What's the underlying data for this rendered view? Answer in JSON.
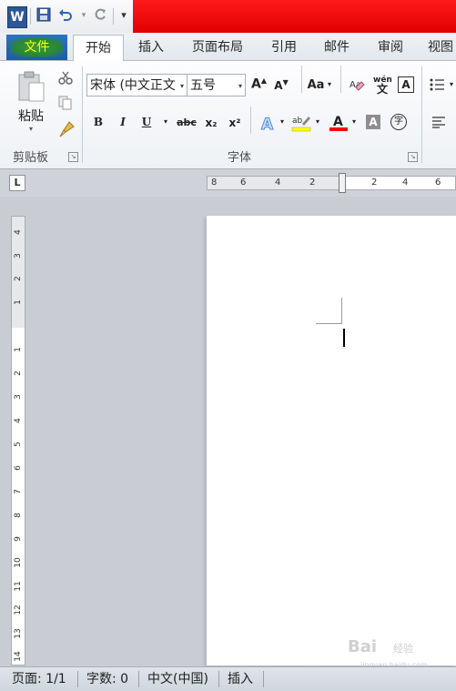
{
  "app": {
    "icon_letter": "W"
  },
  "qat": {
    "save": "save-icon",
    "undo": "undo-icon",
    "redo": "redo-icon",
    "customize": "▾"
  },
  "tabs": [
    {
      "label": "文件"
    },
    {
      "label": "开始"
    },
    {
      "label": "插入"
    },
    {
      "label": "页面布局"
    },
    {
      "label": "引用"
    },
    {
      "label": "邮件"
    },
    {
      "label": "审阅"
    },
    {
      "label": "视图"
    }
  ],
  "clipboard": {
    "paste_label": "粘贴",
    "group_label": "剪贴板"
  },
  "font": {
    "font_name": "宋体 (中文正文",
    "font_size": "五号",
    "group_label": "字体",
    "buttons": {
      "bold": "B",
      "italic": "I",
      "underline": "U",
      "strike": "abc",
      "subscript": "x₂",
      "superscript": "x²",
      "change_case": "Aa",
      "clear_format": "A",
      "font_color": "A",
      "char_shading": "A",
      "enclose": "字",
      "phonetic": "wén",
      "grow": "A",
      "shrink": "A"
    }
  },
  "hruler": {
    "numbers": [
      "8",
      "6",
      "4",
      "2",
      "2",
      "4",
      "6"
    ]
  },
  "vruler": {
    "numbers": [
      "4",
      "3",
      "2",
      "1",
      "1",
      "2",
      "3",
      "4",
      "5",
      "6",
      "7",
      "8",
      "9",
      "10",
      "11",
      "12",
      "13",
      "14"
    ]
  },
  "tabstop": {
    "label": "L"
  },
  "status": {
    "page": "页面: 1/1",
    "words": "字数: 0",
    "language": "中文(中国)",
    "mode": "插入"
  },
  "watermark": {
    "brand": "Bai",
    "text": "经验",
    "url": "jingyan.baidu.com"
  },
  "colors": {
    "accent_red": "#e00000",
    "file_tab": "#1f5aa8",
    "file_text": "#ffff00"
  }
}
